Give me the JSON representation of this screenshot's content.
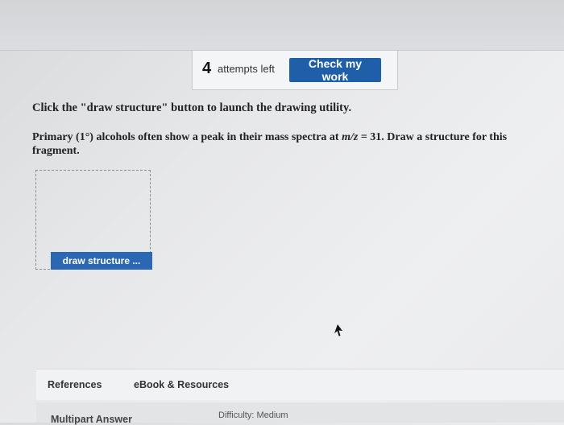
{
  "header": {
    "attempts_count": "4",
    "attempts_label": "attempts left",
    "check_button_label": "Check my work"
  },
  "instructions": "Click the \"draw structure\" button to launch the drawing utility.",
  "question": {
    "text_before": "Primary (1°) alcohols often show a peak in their mass spectra at ",
    "mz_label": "m/z",
    "text_after": " = 31. Draw a structure for this fragment."
  },
  "draw_area": {
    "button_label": "draw structure ..."
  },
  "tabs": {
    "references_label": "References",
    "ebook_label": "eBook & Resources"
  },
  "footer": {
    "question_type": "Multipart Answer",
    "difficulty": "Difficulty: Medium"
  },
  "colors": {
    "primary_button": "#1f5ea8",
    "draw_button": "#2a67b4"
  }
}
